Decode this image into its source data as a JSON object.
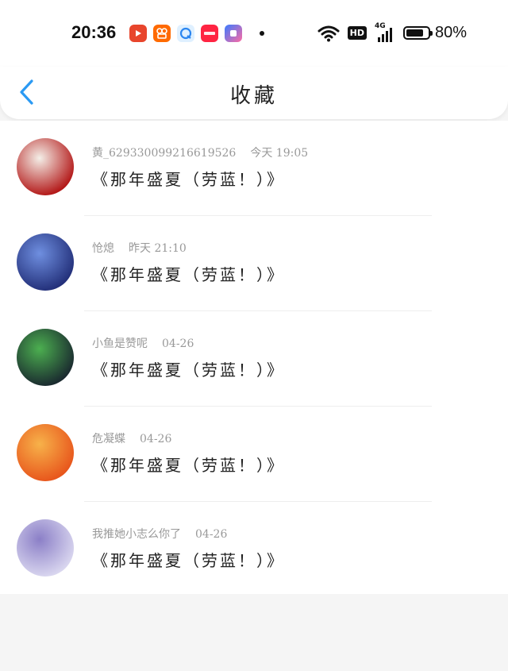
{
  "status": {
    "time": "20:36",
    "hd": "HD",
    "network": "4G",
    "battery": "80%",
    "app_icons": [
      "video-app-icon",
      "kuaishou-icon",
      "browser-icon",
      "xiaohongshu-icon",
      "shortcut-app-icon"
    ]
  },
  "header": {
    "title": "收藏"
  },
  "favorites": [
    {
      "user": "黄_629330099216619526",
      "time": "今天 19:05",
      "message": "《那年盛夏（劳蓝！）》",
      "colors": [
        "#b31818",
        "#f4efe8"
      ]
    },
    {
      "user": "怆熄",
      "time": "昨天 21:10",
      "message": "《那年盛夏（劳蓝！）》",
      "colors": [
        "#23307a",
        "#6f8fe0"
      ]
    },
    {
      "user": "小鱼是赞呢",
      "time": "04-26",
      "message": "《那年盛夏（劳蓝！）》",
      "colors": [
        "#1a2a2f",
        "#4caf50"
      ]
    },
    {
      "user": "危凝蝶",
      "time": "04-26",
      "message": "《那年盛夏（劳蓝！）》",
      "colors": [
        "#e8561c",
        "#f7b24a"
      ]
    },
    {
      "user": "我推她小志么你了",
      "time": "04-26",
      "message": "《那年盛夏（劳蓝！）》",
      "colors": [
        "#d9d6ef",
        "#8b7fc7"
      ]
    }
  ]
}
